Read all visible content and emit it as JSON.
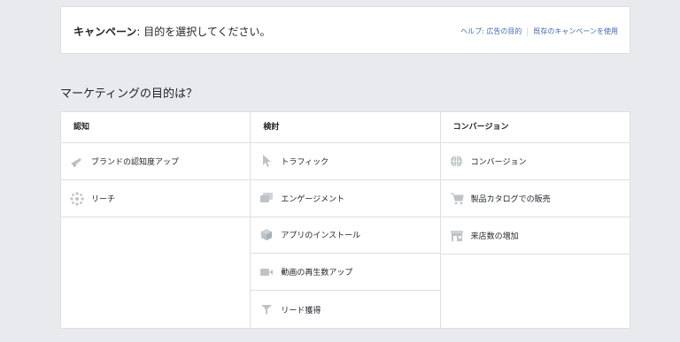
{
  "header": {
    "campaign_label": "キャンペーン",
    "campaign_rest": ": 目的を選択してください。",
    "help_link": "ヘルプ: 広告の目的",
    "existing_link": "既存のキャンペーンを使用"
  },
  "question": "マーケティングの目的は？",
  "columns": [
    {
      "title": "認知",
      "items": [
        {
          "label": "ブランドの認知度アップ",
          "icon": "megaphone-icon"
        },
        {
          "label": "リーチ",
          "icon": "reach-icon"
        }
      ]
    },
    {
      "title": "検討",
      "items": [
        {
          "label": "トラフィック",
          "icon": "cursor-icon"
        },
        {
          "label": "エンゲージメント",
          "icon": "chat-icon"
        },
        {
          "label": "アプリのインストール",
          "icon": "box-icon"
        },
        {
          "label": "動画の再生数アップ",
          "icon": "video-icon"
        },
        {
          "label": "リード獲得",
          "icon": "funnel-icon"
        }
      ]
    },
    {
      "title": "コンバージョン",
      "items": [
        {
          "label": "コンバージョン",
          "icon": "globe-icon"
        },
        {
          "label": "製品カタログでの販売",
          "icon": "cart-icon"
        },
        {
          "label": "来店数の増加",
          "icon": "store-icon"
        }
      ]
    }
  ],
  "colors": {
    "icon": "#bec3c9",
    "link": "#4267b2",
    "border": "#dddfe2"
  }
}
